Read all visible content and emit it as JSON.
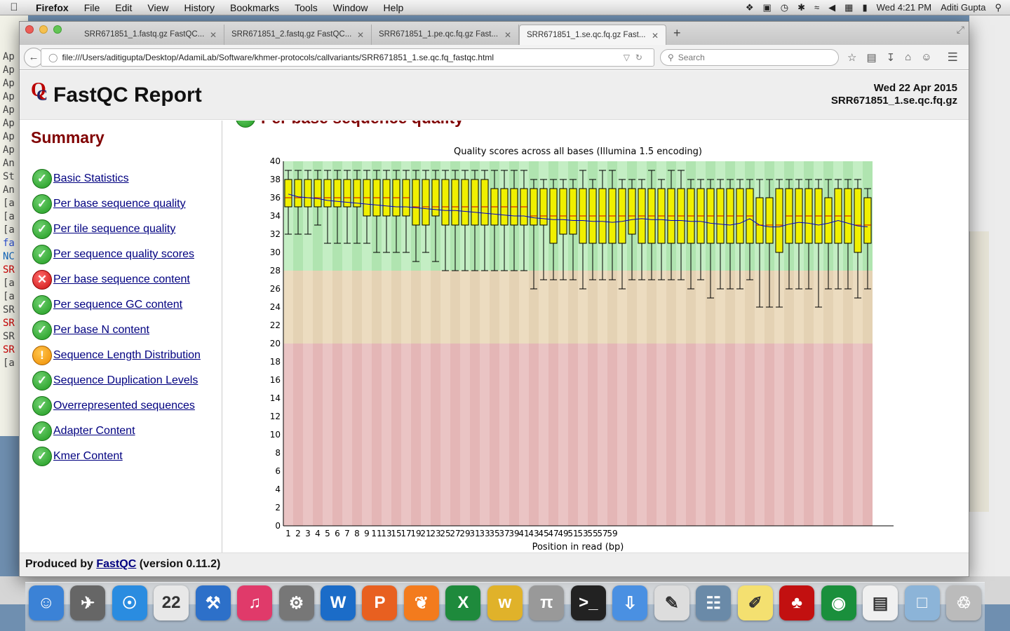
{
  "menubar": {
    "app": "Firefox",
    "items": [
      "File",
      "Edit",
      "View",
      "History",
      "Bookmarks",
      "Tools",
      "Window",
      "Help"
    ],
    "clock": "Wed 4:21 PM",
    "user": "Aditi Gupta"
  },
  "tabs": [
    {
      "label": "SRR671851_1.fastq.gz FastQC...",
      "active": false
    },
    {
      "label": "SRR671851_2.fastq.gz FastQC...",
      "active": false
    },
    {
      "label": "SRR671851_1.pe.qc.fq.gz Fast...",
      "active": false
    },
    {
      "label": "SRR671851_1.se.qc.fq.gz Fast...",
      "active": true
    }
  ],
  "url": "file:///Users/aditigupta/Desktop/AdamiLab/Software/khmer-protocols/callvariants/SRR671851_1.se.qc.fq_fastqc.html",
  "search_placeholder": "Search",
  "report": {
    "title": "FastQC Report",
    "date": "Wed 22 Apr 2015",
    "filename": "SRR671851_1.se.qc.fq.gz",
    "summary_title": "Summary",
    "modules": [
      {
        "label": "Basic Statistics",
        "status": "pass"
      },
      {
        "label": "Per base sequence quality",
        "status": "pass"
      },
      {
        "label": "Per tile sequence quality",
        "status": "pass"
      },
      {
        "label": "Per sequence quality scores",
        "status": "pass"
      },
      {
        "label": "Per base sequence content",
        "status": "fail"
      },
      {
        "label": "Per sequence GC content",
        "status": "pass"
      },
      {
        "label": "Per base N content",
        "status": "pass"
      },
      {
        "label": "Sequence Length Distribution",
        "status": "warn"
      },
      {
        "label": "Sequence Duplication Levels",
        "status": "pass"
      },
      {
        "label": "Overrepresented sequences",
        "status": "pass"
      },
      {
        "label": "Adapter Content",
        "status": "pass"
      },
      {
        "label": "Kmer Content",
        "status": "pass"
      }
    ],
    "section_heading": "Per base sequence quality",
    "footer_prefix": "Produced by",
    "footer_link": "FastQC",
    "footer_suffix": "(version 0.11.2)"
  },
  "chart_data": {
    "type": "box",
    "title": "Quality scores across all bases (Illumina 1.5 encoding)",
    "xlabel": "Position in read (bp)",
    "ylabel": "",
    "ylim": [
      0,
      40
    ],
    "yticks": [
      0,
      2,
      4,
      6,
      8,
      10,
      12,
      14,
      16,
      18,
      20,
      22,
      24,
      26,
      28,
      30,
      32,
      34,
      36,
      38,
      40
    ],
    "categories": [
      "1",
      "2",
      "3",
      "4",
      "5",
      "6",
      "7",
      "8",
      "9",
      "10-11",
      "12-13",
      "14-15",
      "16-17",
      "18-19",
      "20-21",
      "22-23",
      "24-25",
      "26-27",
      "28-29",
      "30-31",
      "32-33",
      "34-35",
      "36-37",
      "38-39",
      "40-41",
      "42-43",
      "44-45",
      "46-47",
      "48-49",
      "50-51",
      "52-53",
      "54-55",
      "56-57",
      "58-59",
      "60-61",
      "62-63",
      "64-65",
      "66-67",
      "68-69",
      "70-71",
      "72-73",
      "74-75",
      "76-77",
      "78-79",
      "80-81",
      "82-83",
      "84-85",
      "86-87",
      "88-89",
      "90-91",
      "92-93",
      "94-95",
      "96-97",
      "98-99",
      "100-101",
      "102-103",
      "104-105",
      "106-107",
      "108-109",
      "110-111"
    ],
    "xtick_labels": [
      "1",
      "2",
      "3",
      "4",
      "5",
      "6",
      "7",
      "8",
      "9",
      "11",
      "13",
      "15",
      "17",
      "19",
      "21",
      "23",
      "25",
      "27",
      "29",
      "31",
      "33",
      "35",
      "37",
      "39",
      "41",
      "43",
      "45",
      "47",
      "49",
      "51",
      "53",
      "55",
      "57",
      "59"
    ],
    "zones": [
      {
        "from": 28,
        "to": 40,
        "color": "#c4eec4",
        "name": "good"
      },
      {
        "from": 20,
        "to": 28,
        "color": "#ecdcc0",
        "name": "reasonable"
      },
      {
        "from": 0,
        "to": 20,
        "color": "#eac4c4",
        "name": "poor"
      }
    ],
    "boxes": [
      {
        "q1": 35,
        "median": 36,
        "q3": 38,
        "p10": 32,
        "p90": 39,
        "mean": 36.4
      },
      {
        "q1": 35,
        "median": 36,
        "q3": 38,
        "p10": 32,
        "p90": 39,
        "mean": 36.1
      },
      {
        "q1": 35,
        "median": 36,
        "q3": 38,
        "p10": 32,
        "p90": 39,
        "mean": 36.0
      },
      {
        "q1": 35,
        "median": 36,
        "q3": 38,
        "p10": 33,
        "p90": 39,
        "mean": 35.9
      },
      {
        "q1": 35,
        "median": 36,
        "q3": 38,
        "p10": 31,
        "p90": 39,
        "mean": 35.7
      },
      {
        "q1": 35,
        "median": 36,
        "q3": 38,
        "p10": 31,
        "p90": 39,
        "mean": 35.6
      },
      {
        "q1": 35,
        "median": 36,
        "q3": 38,
        "p10": 31,
        "p90": 39,
        "mean": 35.5
      },
      {
        "q1": 35,
        "median": 36,
        "q3": 38,
        "p10": 31,
        "p90": 39,
        "mean": 35.4
      },
      {
        "q1": 34,
        "median": 36,
        "q3": 38,
        "p10": 31,
        "p90": 39,
        "mean": 35.3
      },
      {
        "q1": 34,
        "median": 36,
        "q3": 38,
        "p10": 30,
        "p90": 39,
        "mean": 35.2
      },
      {
        "q1": 34,
        "median": 36,
        "q3": 38,
        "p10": 30,
        "p90": 39,
        "mean": 35.1
      },
      {
        "q1": 34,
        "median": 36,
        "q3": 38,
        "p10": 30,
        "p90": 39,
        "mean": 35.0
      },
      {
        "q1": 34,
        "median": 36,
        "q3": 38,
        "p10": 30,
        "p90": 39,
        "mean": 35.0
      },
      {
        "q1": 33,
        "median": 35,
        "q3": 38,
        "p10": 29,
        "p90": 39,
        "mean": 34.9
      },
      {
        "q1": 33,
        "median": 35,
        "q3": 38,
        "p10": 30,
        "p90": 39,
        "mean": 34.8
      },
      {
        "q1": 34,
        "median": 35,
        "q3": 38,
        "p10": 29,
        "p90": 39,
        "mean": 34.7
      },
      {
        "q1": 33,
        "median": 35,
        "q3": 38,
        "p10": 28,
        "p90": 39,
        "mean": 34.6
      },
      {
        "q1": 33,
        "median": 35,
        "q3": 38,
        "p10": 28,
        "p90": 39,
        "mean": 34.6
      },
      {
        "q1": 33,
        "median": 35,
        "q3": 38,
        "p10": 28,
        "p90": 39,
        "mean": 34.5
      },
      {
        "q1": 33,
        "median": 35,
        "q3": 38,
        "p10": 28,
        "p90": 39,
        "mean": 34.4
      },
      {
        "q1": 33,
        "median": 35,
        "q3": 38,
        "p10": 28,
        "p90": 39,
        "mean": 34.3
      },
      {
        "q1": 33,
        "median": 35,
        "q3": 37,
        "p10": 28,
        "p90": 39,
        "mean": 34.2
      },
      {
        "q1": 33,
        "median": 35,
        "q3": 37,
        "p10": 28,
        "p90": 39,
        "mean": 34.1
      },
      {
        "q1": 33,
        "median": 35,
        "q3": 37,
        "p10": 28,
        "p90": 39,
        "mean": 34.0
      },
      {
        "q1": 33,
        "median": 35,
        "q3": 37,
        "p10": 28,
        "p90": 39,
        "mean": 34.0
      },
      {
        "q1": 33,
        "median": 34,
        "q3": 37,
        "p10": 26,
        "p90": 38,
        "mean": 33.8
      },
      {
        "q1": 33,
        "median": 34,
        "q3": 37,
        "p10": 27,
        "p90": 38,
        "mean": 33.7
      },
      {
        "q1": 31,
        "median": 34,
        "q3": 37,
        "p10": 27,
        "p90": 38,
        "mean": 33.6
      },
      {
        "q1": 32,
        "median": 34,
        "q3": 37,
        "p10": 27,
        "p90": 38,
        "mean": 33.6
      },
      {
        "q1": 32,
        "median": 34,
        "q3": 37,
        "p10": 27,
        "p90": 38,
        "mean": 33.5
      },
      {
        "q1": 31,
        "median": 34,
        "q3": 37,
        "p10": 26,
        "p90": 39,
        "mean": 33.5
      },
      {
        "q1": 31,
        "median": 34,
        "q3": 37,
        "p10": 27,
        "p90": 38,
        "mean": 33.4
      },
      {
        "q1": 31,
        "median": 34,
        "q3": 37,
        "p10": 27,
        "p90": 39,
        "mean": 33.4
      },
      {
        "q1": 31,
        "median": 34,
        "q3": 37,
        "p10": 27,
        "p90": 39,
        "mean": 33.3
      },
      {
        "q1": 31,
        "median": 34,
        "q3": 37,
        "p10": 26,
        "p90": 38,
        "mean": 33.4
      },
      {
        "q1": 32,
        "median": 34,
        "q3": 37,
        "p10": 27,
        "p90": 38,
        "mean": 33.6
      },
      {
        "q1": 31,
        "median": 34,
        "q3": 37,
        "p10": 27,
        "p90": 38,
        "mean": 33.7
      },
      {
        "q1": 31,
        "median": 34,
        "q3": 37,
        "p10": 27,
        "p90": 39,
        "mean": 33.6
      },
      {
        "q1": 31,
        "median": 34,
        "q3": 37,
        "p10": 27,
        "p90": 38,
        "mean": 33.6
      },
      {
        "q1": 31,
        "median": 34,
        "q3": 37,
        "p10": 27,
        "p90": 39,
        "mean": 33.5
      },
      {
        "q1": 31,
        "median": 34,
        "q3": 37,
        "p10": 27,
        "p90": 39,
        "mean": 33.5
      },
      {
        "q1": 31,
        "median": 34,
        "q3": 37,
        "p10": 26,
        "p90": 38,
        "mean": 33.4
      },
      {
        "q1": 31,
        "median": 34,
        "q3": 37,
        "p10": 27,
        "p90": 38,
        "mean": 33.4
      },
      {
        "q1": 31,
        "median": 34,
        "q3": 37,
        "p10": 25,
        "p90": 38,
        "mean": 33.2
      },
      {
        "q1": 31,
        "median": 34,
        "q3": 37,
        "p10": 26,
        "p90": 38,
        "mean": 33.1
      },
      {
        "q1": 31,
        "median": 34,
        "q3": 37,
        "p10": 26,
        "p90": 38,
        "mean": 33.0
      },
      {
        "q1": 31,
        "median": 34,
        "q3": 37,
        "p10": 26,
        "p90": 38,
        "mean": 33.2
      },
      {
        "q1": 31,
        "median": 34,
        "q3": 37,
        "p10": 27,
        "p90": 38,
        "mean": 33.7
      },
      {
        "q1": 31,
        "median": 33,
        "q3": 36,
        "p10": 24,
        "p90": 38,
        "mean": 33.0
      },
      {
        "q1": 31,
        "median": 33,
        "q3": 36,
        "p10": 24,
        "p90": 38,
        "mean": 32.8
      },
      {
        "q1": 30,
        "median": 33,
        "q3": 37,
        "p10": 24,
        "p90": 38,
        "mean": 32.8
      },
      {
        "q1": 31,
        "median": 34,
        "q3": 37,
        "p10": 26,
        "p90": 38,
        "mean": 33.1
      },
      {
        "q1": 31,
        "median": 34,
        "q3": 37,
        "p10": 26,
        "p90": 38,
        "mean": 33.3
      },
      {
        "q1": 31,
        "median": 34,
        "q3": 37,
        "p10": 26,
        "p90": 38,
        "mean": 33.2
      },
      {
        "q1": 31,
        "median": 34,
        "q3": 37,
        "p10": 24,
        "p90": 38,
        "mean": 33.0
      },
      {
        "q1": 31,
        "median": 34,
        "q3": 36,
        "p10": 26,
        "p90": 38,
        "mean": 33.2
      },
      {
        "q1": 31,
        "median": 34,
        "q3": 37,
        "p10": 26,
        "p90": 38,
        "mean": 33.5
      },
      {
        "q1": 31,
        "median": 34,
        "q3": 37,
        "p10": 26,
        "p90": 38,
        "mean": 33.2
      },
      {
        "q1": 30,
        "median": 33,
        "q3": 37,
        "p10": 25,
        "p90": 38,
        "mean": 32.9
      },
      {
        "q1": 31,
        "median": 33,
        "q3": 36,
        "p10": 26,
        "p90": 37,
        "mean": 32.8
      }
    ]
  },
  "dock": [
    "Finder",
    "Launchpad",
    "Safari",
    "Calendar",
    "Xcode",
    "iTunes",
    "System Preferences",
    "Word",
    "PowerPoint",
    "Firefox",
    "Excel",
    "TeXworks",
    "LaTeXiT",
    "Terminal",
    "Software Update",
    "Preview",
    "Network Utility",
    "Citeulike",
    "Acrobat",
    "Chrome",
    "Documents",
    "Downloads",
    "Trash"
  ]
}
